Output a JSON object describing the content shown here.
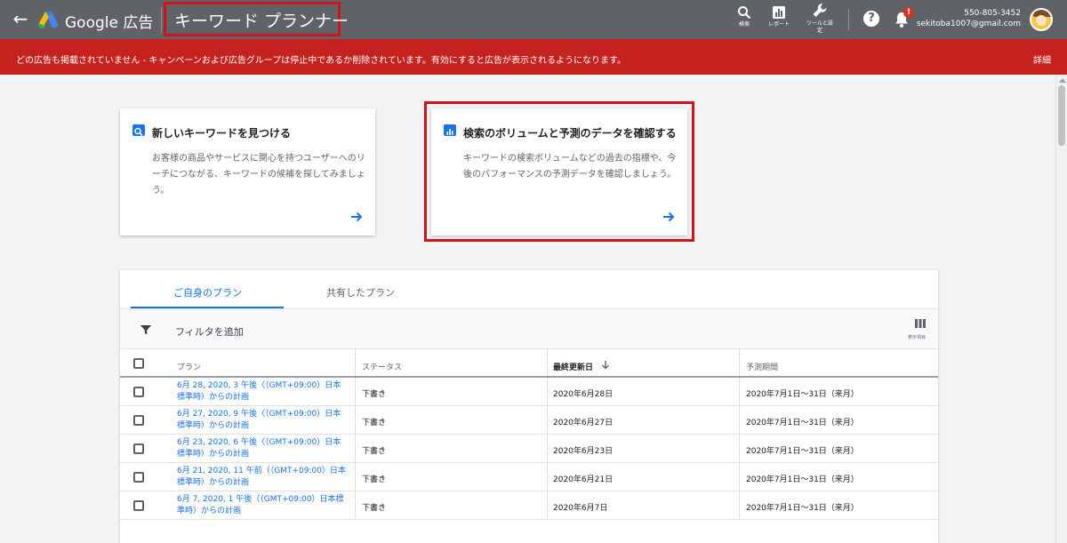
{
  "topbar": {
    "back_icon": "arrow-back-icon",
    "brand": "Google 広告",
    "page_title": "キーワード プランナー",
    "tools": [
      {
        "icon": "search-icon",
        "label": "検索"
      },
      {
        "icon": "reports-icon",
        "label": "レポート"
      },
      {
        "icon": "wrench-icon",
        "label": "ツールと設定"
      }
    ],
    "notification_badge": "!",
    "account_phone": "550-805-3452",
    "account_email": "sekitoba1007@gmail.com"
  },
  "alert": {
    "message": "どの広告も掲載されていません - キャンペーンおよび広告グループは停止中であるか削除されています。有効にすると広告が表示されるようになります。",
    "link": "詳細",
    "color": "#c5221f"
  },
  "cards": [
    {
      "icon": "search-icon",
      "title": "新しいキーワードを見つける",
      "description": "お客様の商品やサービスに関心を持つユーザーへのリーチにつながる、キーワードの候補を探してみましょう。"
    },
    {
      "icon": "bar-chart-icon",
      "title": "検索のボリュームと予測のデータを確認する",
      "description": "キーワードの検索ボリュームなどの過去の指標や、今後のパフォーマンスの予測データを確認しましょう。"
    }
  ],
  "plans": {
    "tabs": [
      "ご自身のプラン",
      "共有したプラン"
    ],
    "active_tab": "ご自身のプラン",
    "filter_label": "フィルタを追加",
    "columns_label": "表示項目",
    "headers": {
      "plan": "プラン",
      "status": "ステータス",
      "last_updated": "最終更新日",
      "forecast_period": "予測期間"
    },
    "rows": [
      {
        "name": "6月 28, 2020, 3 午後（（GMT+09:00）日本標準時）からの計画",
        "status": "下書き",
        "updated": "2020年6月28日",
        "period": "2020年7月1日～31日（来月）"
      },
      {
        "name": "6月 27, 2020, 9 午後（（GMT+09:00）日本標準時）からの計画",
        "status": "下書き",
        "updated": "2020年6月27日",
        "period": "2020年7月1日～31日（来月）"
      },
      {
        "name": "6月 23, 2020, 6 午後（（GMT+09:00）日本標準時）からの計画",
        "status": "下書き",
        "updated": "2020年6月23日",
        "period": "2020年7月1日～31日（来月）"
      },
      {
        "name": "6月 21, 2020, 11 午前（（GMT+09:00）日本標準時）からの計画",
        "status": "下書き",
        "updated": "2020年6月21日",
        "period": "2020年7月1日～31日（来月）"
      },
      {
        "name": "6月 7, 2020, 1 午後（（GMT+09:00）日本標準時）からの計画",
        "status": "下書き",
        "updated": "2020年6月7日",
        "period": "2020年7月1日～31日（来月）"
      }
    ]
  }
}
